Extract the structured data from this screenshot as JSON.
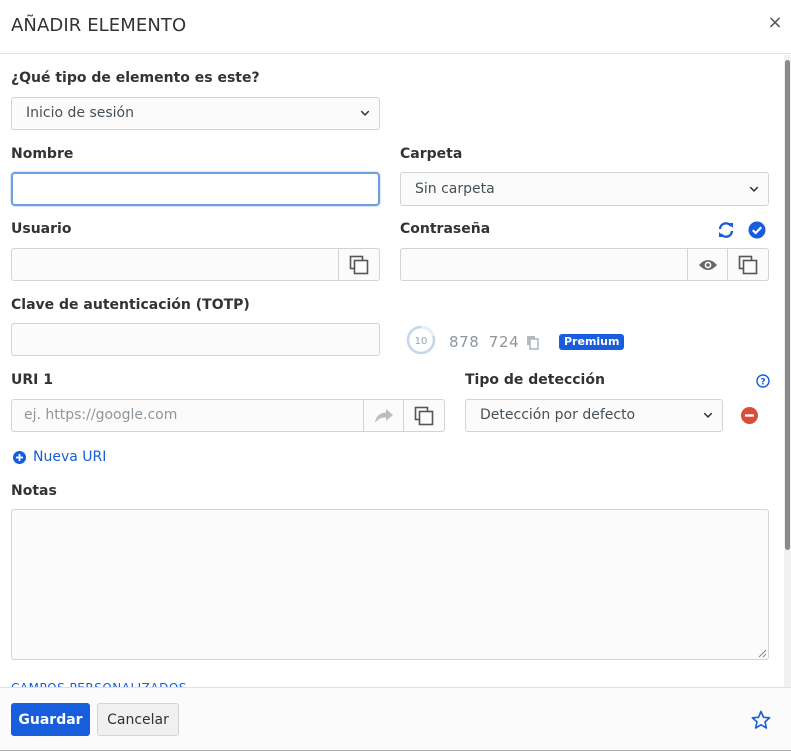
{
  "header": {
    "title": "AÑADIR ELEMENTO",
    "close": "×"
  },
  "form": {
    "type_label": "¿Qué tipo de elemento es este?",
    "type_value": "Inicio de sesión",
    "name_label": "Nombre",
    "name_value": "",
    "folder_label": "Carpeta",
    "folder_value": "Sin carpeta",
    "username_label": "Usuario",
    "username_value": "",
    "password_label": "Contraseña",
    "password_value": "",
    "totp_label": "Clave de autenticación (TOTP)",
    "totp_value": "",
    "totp_seconds": "10",
    "totp_code": "878 724",
    "premium_badge": "Premium",
    "uri_label": "URI 1",
    "uri_placeholder": "ej. https://google.com",
    "match_label": "Tipo de detección",
    "match_value": "Detección por defecto",
    "new_uri": "Nueva URI",
    "notes_label": "Notas",
    "notes_value": "",
    "custom_fields": "CAMPOS PERSONALIZADOS"
  },
  "footer": {
    "save": "Guardar",
    "cancel": "Cancelar"
  },
  "colors": {
    "accent": "#175ddc",
    "danger": "#dd4b39",
    "border": "#ced4da",
    "focus": "#6fa0dd"
  },
  "icons": [
    "close-icon",
    "refresh-icon",
    "check-circle-icon",
    "eye-icon",
    "copy-icon",
    "launch-icon",
    "question-circle-icon",
    "minus-circle-icon",
    "plus-circle-icon",
    "star-icon",
    "chevron-down-icon"
  ]
}
